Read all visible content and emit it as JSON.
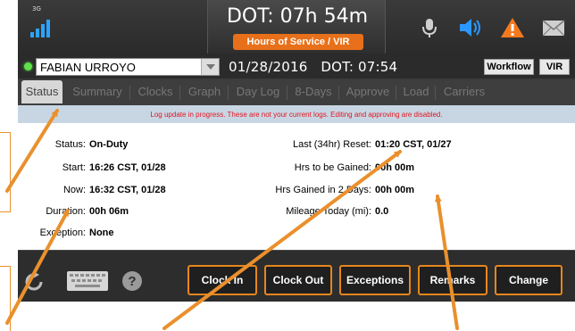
{
  "statusbar": {
    "network_label": "3G",
    "dot_title": "DOT: 07h 54m",
    "hos_label": "Hours of Service / VIR"
  },
  "driver": {
    "name": "FABIAN URROYO",
    "date_info": "01/28/2016   DOT: 07:54",
    "workflow_label": "Workflow",
    "vir_label": "VIR"
  },
  "tabs": [
    {
      "label": "Status",
      "active": true
    },
    {
      "label": "Summary"
    },
    {
      "label": "Clocks"
    },
    {
      "label": "Graph"
    },
    {
      "label": "Day Log"
    },
    {
      "label": "8-Days"
    },
    {
      "label": "Approve"
    },
    {
      "label": "Load"
    },
    {
      "label": "Carriers"
    }
  ],
  "notice": "Log update in progress. These are not your current logs. Editing and approving are disabled.",
  "fields": {
    "status": {
      "label": "Status:",
      "value": "On-Duty"
    },
    "start": {
      "label": "Start:",
      "value": "16:26 CST, 01/28"
    },
    "now": {
      "label": "Now:",
      "value": "16:32 CST, 01/28"
    },
    "duration": {
      "label": "Duration:",
      "value": "00h 06m"
    },
    "exception": {
      "label": "Exception:",
      "value": "None"
    },
    "last_reset": {
      "label": "Last (34hr) Reset:",
      "value": "01:20 CST, 01/27"
    },
    "hrs_to_gain": {
      "label": "Hrs to be Gained:",
      "value": "00h 00m"
    },
    "hrs_gained": {
      "label": "Hrs Gained in 2 Days:",
      "value": "00h 00m"
    },
    "mileage": {
      "label": "Mileage Today (mi):",
      "value": "0.0"
    }
  },
  "actions": {
    "clock_in": "Clock In",
    "clock_out": "Clock Out",
    "exceptions": "Exceptions",
    "remarks": "Remarks",
    "change": "Change"
  },
  "icons": [
    "signal-icon",
    "microphone-icon",
    "speaker-icon",
    "warning-icon",
    "mail-icon",
    "refresh-icon",
    "keyboard-icon",
    "help-icon"
  ],
  "colors": {
    "accent": "#e8701a",
    "notice_text": "#e3151d",
    "notice_bg": "#c8d6e4",
    "annotation": "#e9902d",
    "signal": "#2aa4ff"
  }
}
